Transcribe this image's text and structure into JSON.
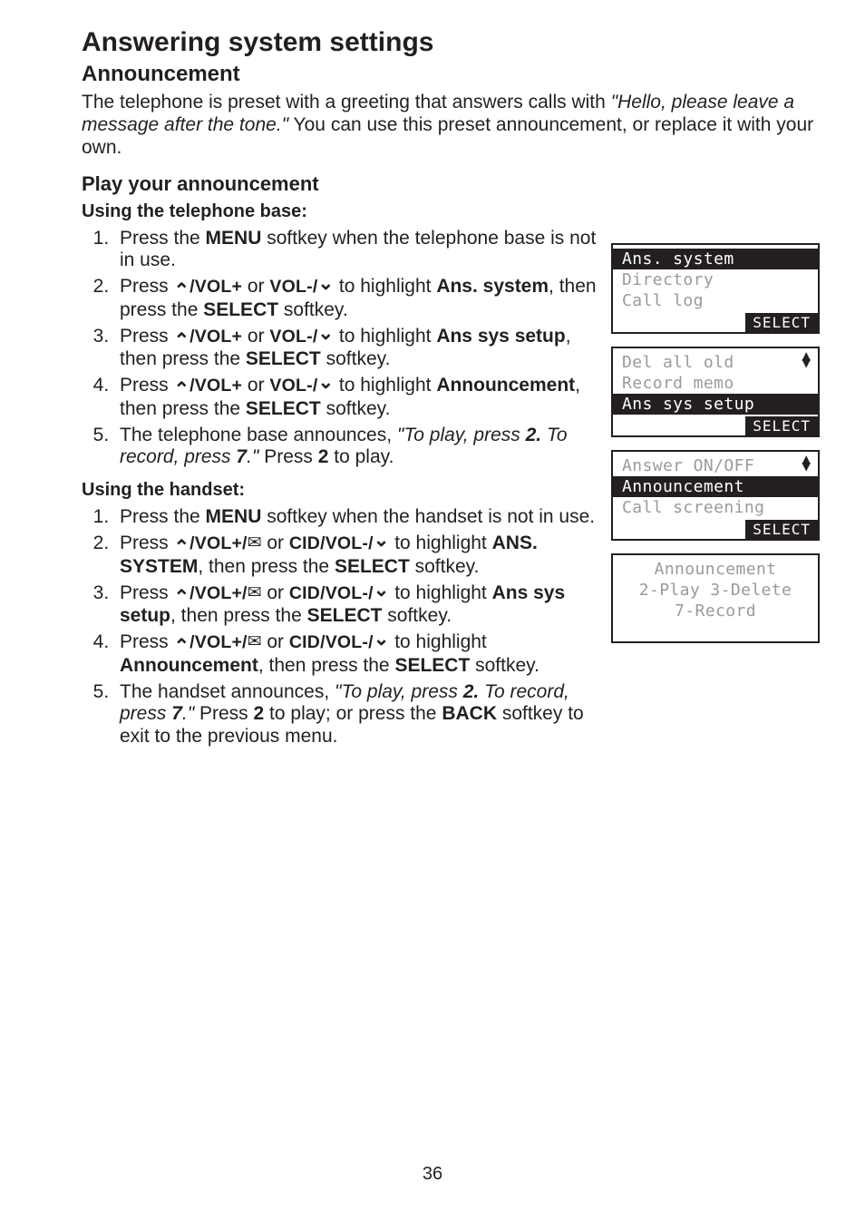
{
  "title": "Answering system settings",
  "section": "Announcement",
  "intro_a": "The telephone is preset with a greeting that answers calls with ",
  "intro_quote": "\"Hello, please leave a message after the tone.\"",
  "intro_b": "  You can use this preset announcement, or replace it with your own.",
  "sub1": "Play your announcement",
  "base_hdr": "Using the telephone base:",
  "base": {
    "s1a": "Press the ",
    "menu": "MENU",
    "s1b": " softkey when the telephone base is not in use.",
    "s2a": "Press ",
    "volup": "/VOL+",
    "or": " or ",
    "voldn": "VOL-/",
    "s2b": " to highlight ",
    "ans_sys": "Ans. system",
    "then_select": ", then press the ",
    "select": "SELECT",
    "softkey": " softkey.",
    "ans_setup": "Ans sys setup",
    "announcement": "Announcement",
    "s5a": "The telephone base announces, ",
    "s5quote": "\"To play, press ",
    "two": "2.",
    "s5quote2": " To record, press ",
    "seven": "7",
    "s5quote3": ".\"",
    "s5b": "  Press ",
    "two_plain": "2",
    "s5c": " to play."
  },
  "hs_hdr": "Using the handset:",
  "hs": {
    "s1a": "Press the ",
    "menu": "MENU",
    "s1b": " softkey when the handset is not in use.",
    "s2a": "Press ",
    "volup": "/VOL+/",
    "or": " or ",
    "cidvoldn": "CID/VOL-/",
    "hl": " to highlight ",
    "ans_sys": "ANS. SYSTEM",
    "then_select": ", then press the ",
    "select": "SELECT",
    "softkey": " softkey.",
    "ans_setup": "Ans sys setup",
    "announcement": "Announcement",
    "s5a": "The handset announces, ",
    "s5quote": " \"To play, press ",
    "two": "2.",
    "s5quote2": " To record, press ",
    "seven": "7",
    "s5quote3": ".\"",
    "s5b": "  Press ",
    "two_plain": "2",
    "s5c": " to play; or press the ",
    "back": "BACK",
    "s5d": " softkey to exit to the previous menu."
  },
  "screens": {
    "s1": {
      "l1": "Ans. system",
      "l2": "Directory",
      "l3": "Call log",
      "key": "SELECT"
    },
    "s2": {
      "l1": "Del all old",
      "l2": "Record memo",
      "l3": "Ans sys setup",
      "key": "SELECT"
    },
    "s3": {
      "l1": "Answer ON/OFF",
      "l2": "Announcement",
      "l3": "Call screening",
      "key": "SELECT"
    },
    "s4": {
      "l1": "Announcement",
      "l2": "2-Play 3-Delete",
      "l3": "7-Record"
    }
  },
  "page_number": "36"
}
